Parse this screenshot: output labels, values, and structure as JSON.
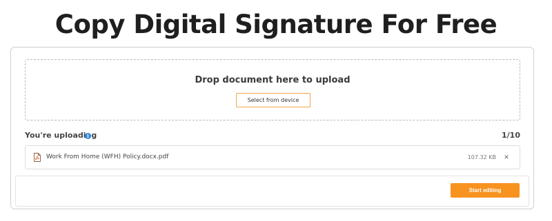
{
  "page": {
    "title": "Copy Digital Signature For Free"
  },
  "dropzone": {
    "text": "Drop document here to upload",
    "select_label": "Select from device"
  },
  "uploads": {
    "label": "You're uploading",
    "count": "1/10",
    "files": [
      {
        "name": "Work From Home (WFH) Policy.docx.pdf",
        "size": "107.32 KB",
        "icon": "pdf-file-icon"
      }
    ]
  },
  "footer": {
    "start_label": "Start editing"
  },
  "colors": {
    "accent": "#f7931e",
    "accent_border": "#f0a64a",
    "info": "#2e86de"
  }
}
